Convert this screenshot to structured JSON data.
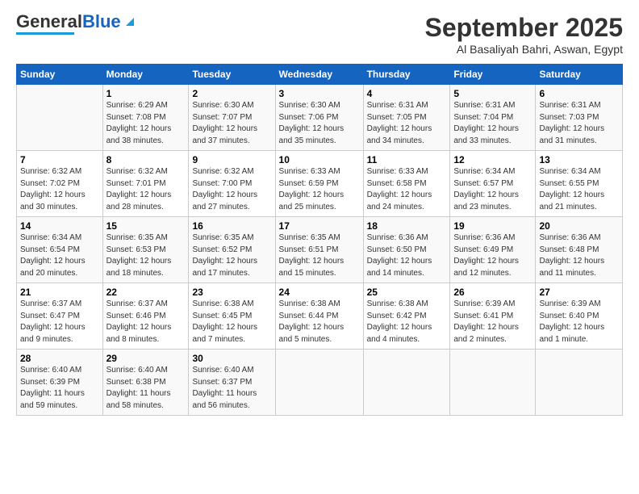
{
  "header": {
    "logo_general": "General",
    "logo_blue": "Blue",
    "month": "September 2025",
    "location": "Al Basaliyah Bahri, Aswan, Egypt"
  },
  "days_of_week": [
    "Sunday",
    "Monday",
    "Tuesday",
    "Wednesday",
    "Thursday",
    "Friday",
    "Saturday"
  ],
  "weeks": [
    [
      {
        "num": "",
        "info": ""
      },
      {
        "num": "1",
        "info": "Sunrise: 6:29 AM\nSunset: 7:08 PM\nDaylight: 12 hours\nand 38 minutes."
      },
      {
        "num": "2",
        "info": "Sunrise: 6:30 AM\nSunset: 7:07 PM\nDaylight: 12 hours\nand 37 minutes."
      },
      {
        "num": "3",
        "info": "Sunrise: 6:30 AM\nSunset: 7:06 PM\nDaylight: 12 hours\nand 35 minutes."
      },
      {
        "num": "4",
        "info": "Sunrise: 6:31 AM\nSunset: 7:05 PM\nDaylight: 12 hours\nand 34 minutes."
      },
      {
        "num": "5",
        "info": "Sunrise: 6:31 AM\nSunset: 7:04 PM\nDaylight: 12 hours\nand 33 minutes."
      },
      {
        "num": "6",
        "info": "Sunrise: 6:31 AM\nSunset: 7:03 PM\nDaylight: 12 hours\nand 31 minutes."
      }
    ],
    [
      {
        "num": "7",
        "info": "Sunrise: 6:32 AM\nSunset: 7:02 PM\nDaylight: 12 hours\nand 30 minutes."
      },
      {
        "num": "8",
        "info": "Sunrise: 6:32 AM\nSunset: 7:01 PM\nDaylight: 12 hours\nand 28 minutes."
      },
      {
        "num": "9",
        "info": "Sunrise: 6:32 AM\nSunset: 7:00 PM\nDaylight: 12 hours\nand 27 minutes."
      },
      {
        "num": "10",
        "info": "Sunrise: 6:33 AM\nSunset: 6:59 PM\nDaylight: 12 hours\nand 25 minutes."
      },
      {
        "num": "11",
        "info": "Sunrise: 6:33 AM\nSunset: 6:58 PM\nDaylight: 12 hours\nand 24 minutes."
      },
      {
        "num": "12",
        "info": "Sunrise: 6:34 AM\nSunset: 6:57 PM\nDaylight: 12 hours\nand 23 minutes."
      },
      {
        "num": "13",
        "info": "Sunrise: 6:34 AM\nSunset: 6:55 PM\nDaylight: 12 hours\nand 21 minutes."
      }
    ],
    [
      {
        "num": "14",
        "info": "Sunrise: 6:34 AM\nSunset: 6:54 PM\nDaylight: 12 hours\nand 20 minutes."
      },
      {
        "num": "15",
        "info": "Sunrise: 6:35 AM\nSunset: 6:53 PM\nDaylight: 12 hours\nand 18 minutes."
      },
      {
        "num": "16",
        "info": "Sunrise: 6:35 AM\nSunset: 6:52 PM\nDaylight: 12 hours\nand 17 minutes."
      },
      {
        "num": "17",
        "info": "Sunrise: 6:35 AM\nSunset: 6:51 PM\nDaylight: 12 hours\nand 15 minutes."
      },
      {
        "num": "18",
        "info": "Sunrise: 6:36 AM\nSunset: 6:50 PM\nDaylight: 12 hours\nand 14 minutes."
      },
      {
        "num": "19",
        "info": "Sunrise: 6:36 AM\nSunset: 6:49 PM\nDaylight: 12 hours\nand 12 minutes."
      },
      {
        "num": "20",
        "info": "Sunrise: 6:36 AM\nSunset: 6:48 PM\nDaylight: 12 hours\nand 11 minutes."
      }
    ],
    [
      {
        "num": "21",
        "info": "Sunrise: 6:37 AM\nSunset: 6:47 PM\nDaylight: 12 hours\nand 9 minutes."
      },
      {
        "num": "22",
        "info": "Sunrise: 6:37 AM\nSunset: 6:46 PM\nDaylight: 12 hours\nand 8 minutes."
      },
      {
        "num": "23",
        "info": "Sunrise: 6:38 AM\nSunset: 6:45 PM\nDaylight: 12 hours\nand 7 minutes."
      },
      {
        "num": "24",
        "info": "Sunrise: 6:38 AM\nSunset: 6:44 PM\nDaylight: 12 hours\nand 5 minutes."
      },
      {
        "num": "25",
        "info": "Sunrise: 6:38 AM\nSunset: 6:42 PM\nDaylight: 12 hours\nand 4 minutes."
      },
      {
        "num": "26",
        "info": "Sunrise: 6:39 AM\nSunset: 6:41 PM\nDaylight: 12 hours\nand 2 minutes."
      },
      {
        "num": "27",
        "info": "Sunrise: 6:39 AM\nSunset: 6:40 PM\nDaylight: 12 hours\nand 1 minute."
      }
    ],
    [
      {
        "num": "28",
        "info": "Sunrise: 6:40 AM\nSunset: 6:39 PM\nDaylight: 11 hours\nand 59 minutes."
      },
      {
        "num": "29",
        "info": "Sunrise: 6:40 AM\nSunset: 6:38 PM\nDaylight: 11 hours\nand 58 minutes."
      },
      {
        "num": "30",
        "info": "Sunrise: 6:40 AM\nSunset: 6:37 PM\nDaylight: 11 hours\nand 56 minutes."
      },
      {
        "num": "",
        "info": ""
      },
      {
        "num": "",
        "info": ""
      },
      {
        "num": "",
        "info": ""
      },
      {
        "num": "",
        "info": ""
      }
    ]
  ]
}
